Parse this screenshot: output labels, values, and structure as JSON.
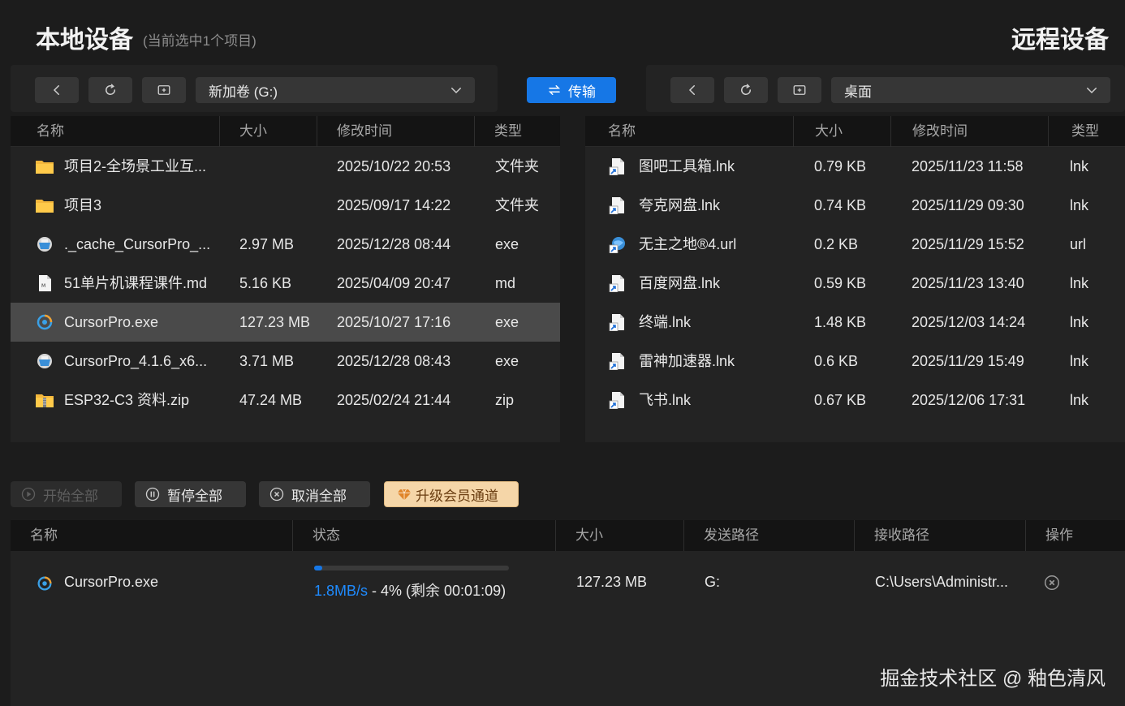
{
  "header": {
    "local_title": "本地设备",
    "local_subtitle": "(当前选中1个项目)",
    "remote_title": "远程设备"
  },
  "toolbar": {
    "local_path": "新加卷 (G:)",
    "remote_path": "桌面",
    "transfer_label": "传输"
  },
  "local_table": {
    "columns": [
      "名称",
      "大小",
      "修改时间",
      "类型"
    ],
    "rows": [
      {
        "name": "项目2-全场景工业互...",
        "size": "",
        "modified": "2025/10/22 20:53",
        "type": "文件夹",
        "icon": "folder-icon"
      },
      {
        "name": "项目3",
        "size": "",
        "modified": "2025/09/17 14:22",
        "type": "文件夹",
        "icon": "folder-icon"
      },
      {
        "name": "._cache_CursorPro_...",
        "size": "2.97 MB",
        "modified": "2025/12/28 08:44",
        "type": "exe",
        "icon": "installer-icon"
      },
      {
        "name": "51单片机课程课件.md",
        "size": "5.16 KB",
        "modified": "2025/04/09 20:47",
        "type": "md",
        "icon": "markdown-file-icon"
      },
      {
        "name": "CursorPro.exe",
        "size": "127.23 MB",
        "modified": "2025/10/27 17:16",
        "type": "exe",
        "icon": "cursorpro-app-icon"
      },
      {
        "name": "CursorPro_4.1.6_x6...",
        "size": "3.71 MB",
        "modified": "2025/12/28 08:43",
        "type": "exe",
        "icon": "installer-icon"
      },
      {
        "name": "ESP32-C3 资料.zip",
        "size": "47.24 MB",
        "modified": "2025/02/24 21:44",
        "type": "zip",
        "icon": "zip-folder-icon"
      }
    ],
    "selected_index": 4
  },
  "remote_table": {
    "columns": [
      "名称",
      "大小",
      "修改时间",
      "类型"
    ],
    "rows": [
      {
        "name": "图吧工具箱.lnk",
        "size": "0.79 KB",
        "modified": "2025/11/23 11:58",
        "type": "lnk",
        "icon": "shortcut-icon"
      },
      {
        "name": "夸克网盘.lnk",
        "size": "0.74 KB",
        "modified": "2025/11/29 09:30",
        "type": "lnk",
        "icon": "shortcut-icon"
      },
      {
        "name": "无主之地®4.url",
        "size": "0.2 KB",
        "modified": "2025/11/29 15:52",
        "type": "url",
        "icon": "url-shortcut-icon"
      },
      {
        "name": "百度网盘.lnk",
        "size": "0.59 KB",
        "modified": "2025/11/23 13:40",
        "type": "lnk",
        "icon": "shortcut-icon"
      },
      {
        "name": "终端.lnk",
        "size": "1.48 KB",
        "modified": "2025/12/03 14:24",
        "type": "lnk",
        "icon": "shortcut-icon"
      },
      {
        "name": "雷神加速器.lnk",
        "size": "0.6 KB",
        "modified": "2025/11/29 15:49",
        "type": "lnk",
        "icon": "shortcut-icon"
      },
      {
        "name": "飞书.lnk",
        "size": "0.67 KB",
        "modified": "2025/12/06 17:31",
        "type": "lnk",
        "icon": "shortcut-icon"
      }
    ]
  },
  "transfer_controls": {
    "start_all": "开始全部",
    "pause_all": "暂停全部",
    "cancel_all": "取消全部",
    "upgrade": "升级会员通道"
  },
  "transfer_queue": {
    "columns": [
      "名称",
      "状态",
      "大小",
      "发送路径",
      "接收路径",
      "操作"
    ],
    "items": [
      {
        "name": "CursorPro.exe",
        "speed": "1.8MB/s",
        "status_rest": " - 4% (剩余 00:01:09)",
        "progress_percent": 4,
        "size": "127.23 MB",
        "send_path": "G:",
        "receive_path": "C:\\Users\\Administr..."
      }
    ]
  },
  "watermark": "掘金技术社区 @ 釉色清风",
  "colors": {
    "accent": "#1677e6",
    "speed_text": "#1f8bff",
    "vip_background": "#f5d6a8",
    "selected_row": "#4a4a4a"
  }
}
